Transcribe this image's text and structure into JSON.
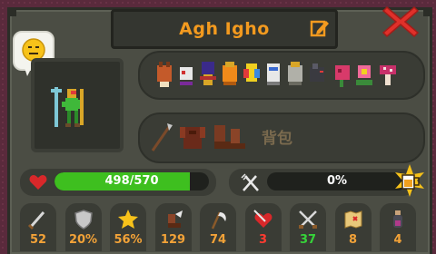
{
  "profile": {
    "name": "Agh Igho",
    "backpack_label": "背包"
  },
  "health": {
    "text": "498/570",
    "current": 498,
    "max": 570,
    "color": "#3ebf1f"
  },
  "hunger": {
    "text": "0%",
    "fraction": 0
  },
  "stats": [
    {
      "icon": "sword-icon",
      "value": "52",
      "color": "#f2a238"
    },
    {
      "icon": "shield-icon",
      "value": "20%",
      "color": "#f2a238"
    },
    {
      "icon": "star-burst-icon",
      "value": "56%",
      "color": "#f2a238"
    },
    {
      "icon": "winged-boot-icon",
      "value": "129",
      "color": "#f2a238"
    },
    {
      "icon": "scythe-icon",
      "value": "74",
      "color": "#f2a238"
    },
    {
      "icon": "heart-dagger-icon",
      "value": "3",
      "color": "#ff3b30"
    },
    {
      "icon": "crossed-swords-icon",
      "value": "37",
      "color": "#36d33a"
    },
    {
      "icon": "treasure-map-icon",
      "value": "8",
      "color": "#f2a238"
    },
    {
      "icon": "potion-icon",
      "value": "4",
      "color": "#f2a238"
    }
  ],
  "colors": {
    "accent": "#f39a1f",
    "panel": "#4b4d44",
    "background": "#5a2a3c",
    "close": "#e0302a"
  }
}
